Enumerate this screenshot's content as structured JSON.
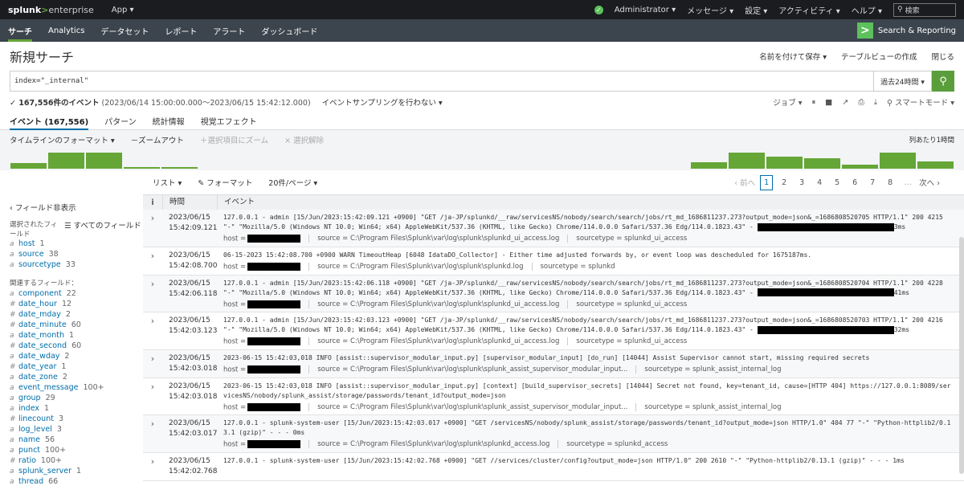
{
  "topbar": {
    "logo_main": "splunk",
    "logo_gt": ">",
    "logo_ent": "enterprise",
    "app_menu": "App ▾",
    "user": "Administrator ▾",
    "messages": "メッセージ ▾",
    "settings": "設定 ▾",
    "activity": "アクティビティ ▾",
    "help": "ヘルプ ▾",
    "search_placeholder": "検索"
  },
  "nav": {
    "items": [
      "サーチ",
      "Analytics",
      "データセット",
      "レポート",
      "アラート",
      "ダッシュボード"
    ],
    "app_name": "Search & Reporting"
  },
  "page": {
    "title": "新規サーチ",
    "save_as": "名前を付けて保存 ▾",
    "create_table": "テーブルビューの作成",
    "close": "閉じる"
  },
  "search": {
    "query": "index=\"_internal\"",
    "timerange": "過去24時間 ▾"
  },
  "status": {
    "count": "✓ 167,556件のイベント",
    "range": "(2023/06/14 15:00:00.000～2023/06/15 15:42:12.000)",
    "sampling": "イベントサンプリングを行わない ▾",
    "job": "ジョブ ▾",
    "mode": "⚲ スマートモード ▾"
  },
  "tabs": [
    "イベント (167,556)",
    "パターン",
    "統計情報",
    "視覚エフェクト"
  ],
  "timeline": {
    "format": "タイムラインのフォーマット ▾",
    "zoom_out": "－ズームアウト",
    "zoom_sel": "＋選択項目にズーム",
    "deselect": "× 選択解除",
    "per": "列あたり1時間",
    "bars": [
      0.35,
      1.0,
      1.0,
      0.12,
      0.1,
      0,
      0,
      0,
      0,
      0,
      0,
      0,
      0,
      0,
      0,
      0,
      0,
      0,
      0.4,
      1.0,
      0.75,
      0.65,
      0.25,
      1.0,
      0.45
    ]
  },
  "list_controls": {
    "list": "リスト ▾",
    "format": "✎ フォーマット",
    "per_page": "20件/ページ ▾",
    "prev": "‹ 前へ",
    "pages": [
      "1",
      "2",
      "3",
      "4",
      "5",
      "6",
      "7",
      "8",
      "…"
    ],
    "next": "次へ ›"
  },
  "sidebar": {
    "hide": "‹ フィールド非表示",
    "selected_head": "選択されたフィールド",
    "all_fields": "☰ すべてのフィールド",
    "selected": [
      {
        "type": "a",
        "name": "host",
        "count": "1"
      },
      {
        "type": "a",
        "name": "source",
        "count": "38"
      },
      {
        "type": "a",
        "name": "sourcetype",
        "count": "33"
      }
    ],
    "interesting_head": "関連するフィールド：",
    "interesting": [
      {
        "type": "a",
        "name": "component",
        "count": "22"
      },
      {
        "type": "#",
        "name": "date_hour",
        "count": "12"
      },
      {
        "type": "#",
        "name": "date_mday",
        "count": "2"
      },
      {
        "type": "#",
        "name": "date_minute",
        "count": "60"
      },
      {
        "type": "a",
        "name": "date_month",
        "count": "1"
      },
      {
        "type": "#",
        "name": "date_second",
        "count": "60"
      },
      {
        "type": "a",
        "name": "date_wday",
        "count": "2"
      },
      {
        "type": "#",
        "name": "date_year",
        "count": "1"
      },
      {
        "type": "a",
        "name": "date_zone",
        "count": "2"
      },
      {
        "type": "a",
        "name": "event_message",
        "count": "100+"
      },
      {
        "type": "a",
        "name": "group",
        "count": "29"
      },
      {
        "type": "a",
        "name": "index",
        "count": "1"
      },
      {
        "type": "#",
        "name": "linecount",
        "count": "3"
      },
      {
        "type": "a",
        "name": "log_level",
        "count": "3"
      },
      {
        "type": "a",
        "name": "name",
        "count": "56"
      },
      {
        "type": "a",
        "name": "punct",
        "count": "100+"
      },
      {
        "type": "#",
        "name": "ratio",
        "count": "100+"
      },
      {
        "type": "a",
        "name": "splunk_server",
        "count": "1"
      },
      {
        "type": "a",
        "name": "thread",
        "count": "66"
      }
    ]
  },
  "events_header": {
    "i": "i",
    "time": "時間",
    "event": "イベント"
  },
  "events": [
    {
      "date": "2023/06/15",
      "time": "15:42:09.121",
      "raw": "127.0.0.1 - admin [15/Jun/2023:15:42:09.121 +0900] \"GET /ja-JP/splunkd/__raw/servicesNS/nobody/search/search/jobs/rt_md_1686811237.273?output_mode=json&_=1686808520705 HTTP/1.1\" 200 4215 \"-\" \"Mozilla/5.0 (Windows NT 10.0; Win64; x64) AppleWebKit/537.36 (KHTML, like Gecko) Chrome/114.0.0.0 Safari/537.36 Edg/114.0.1823.43\" -",
      "raw_end": "3ms",
      "source": "source = C:\\Program Files\\Splunk\\var\\log\\splunk\\splunkd_ui_access.log",
      "sourcetype": "sourcetype = splunkd_ui_access"
    },
    {
      "date": "2023/06/15",
      "time": "15:42:08.700",
      "raw": "06-15-2023 15:42:08.700 +0900 WARN  TimeoutHeap [6048 IdataDO_Collector] - Either time adjusted forwards by, or event loop was descheduled for 1675187ms.",
      "raw_end": "",
      "source": "source = C:\\Program Files\\Splunk\\var\\log\\splunk\\splunkd.log",
      "sourcetype": "sourcetype = splunkd"
    },
    {
      "date": "2023/06/15",
      "time": "15:42:06.118",
      "raw": "127.0.0.1 - admin [15/Jun/2023:15:42:06.118 +0900] \"GET /ja-JP/splunkd/__raw/servicesNS/nobody/search/search/jobs/rt_md_1686811237.273?output_mode=json&_=1686808520704 HTTP/1.1\" 200 4228 \"-\" \"Mozilla/5.0 (Windows NT 10.0; Win64; x64) AppleWebKit/537.36 (KHTML, like Gecko) Chrome/114.0.0.0 Safari/537.36 Edg/114.0.1823.43\" -",
      "raw_end": "41ms",
      "source": "source = C:\\Program Files\\Splunk\\var\\log\\splunk\\splunkd_ui_access.log",
      "sourcetype": "sourcetype = splunkd_ui_access"
    },
    {
      "date": "2023/06/15",
      "time": "15:42:03.123",
      "raw": "127.0.0.1 - admin [15/Jun/2023:15:42:03.123 +0900] \"GET /ja-JP/splunkd/__raw/servicesNS/nobody/search/search/jobs/rt_md_1686811237.273?output_mode=json&_=1686808520703 HTTP/1.1\" 200 4216 \"-\" \"Mozilla/5.0 (Windows NT 10.0; Win64; x64) AppleWebKit/537.36 (KHTML, like Gecko) Chrome/114.0.0.0 Safari/537.36 Edg/114.0.1823.43\" -",
      "raw_end": "32ms",
      "source": "source = C:\\Program Files\\Splunk\\var\\log\\splunk\\splunkd_ui_access.log",
      "sourcetype": "sourcetype = splunkd_ui_access"
    },
    {
      "date": "2023/06/15",
      "time": "15:42:03.018",
      "raw": "2023-06-15 15:42:03,018 INFO [assist::supervisor_modular_input.py] [supervisor_modular_input] [do_run] [14044] Assist Supervisor cannot start, missing required secrets",
      "raw_end": "",
      "source": "source = C:\\Program Files\\Splunk\\var\\log\\splunk\\splunk_assist_supervisor_modular_input...",
      "sourcetype": "sourcetype = splunk_assist_internal_log"
    },
    {
      "date": "2023/06/15",
      "time": "15:42:03.018",
      "raw": "2023-06-15 15:42:03,018 INFO [assist::supervisor_modular_input.py] [context] [build_supervisor_secrets] [14044] Secret not found, key=tenant_id, cause=[HTTP 404] https://127.0.0.1:8089/servicesNS/nobody/splunk_assist/storage/passwords/tenant_id?output_mode=json",
      "raw_end": "",
      "source": "source = C:\\Program Files\\Splunk\\var\\log\\splunk\\splunk_assist_supervisor_modular_input...",
      "sourcetype": "sourcetype = splunk_assist_internal_log"
    },
    {
      "date": "2023/06/15",
      "time": "15:42:03.017",
      "raw": "127.0.0.1 - splunk-system-user [15/Jun/2023:15:42:03.017 +0900] \"GET /servicesNS/nobody/splunk_assist/storage/passwords/tenant_id?output_mode=json HTTP/1.0\" 404 77 \"-\" \"Python-httplib2/0.13.1 (gzip)\" - - - 0ms",
      "raw_end": "",
      "source": "source = C:\\Program Files\\Splunk\\var\\log\\splunk\\splunkd_access.log",
      "sourcetype": "sourcetype = splunkd_access"
    },
    {
      "date": "2023/06/15",
      "time": "15:42:02.768",
      "raw": "127.0.0.1 - splunk-system-user [15/Jun/2023:15:42:02.768 +0900] \"GET //services/cluster/config?output_mode=json HTTP/1.0\" 200 2610 \"-\" \"Python-httplib2/0.13.1 (gzip)\" - - - 1ms",
      "raw_end": "",
      "source": "",
      "sourcetype": ""
    }
  ],
  "host_label": "host ="
}
